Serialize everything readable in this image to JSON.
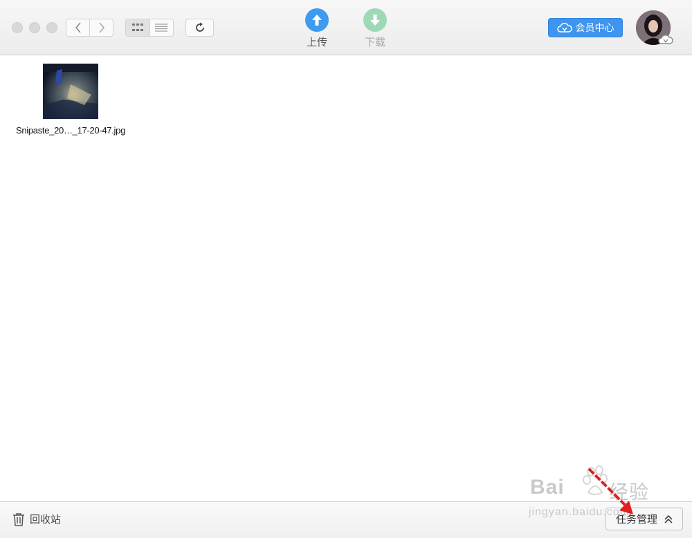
{
  "toolbar": {
    "upload_label": "上传",
    "download_label": "下载",
    "vip_label": "会员中心"
  },
  "files": [
    {
      "name": "Snipaste_20…_17-20-47.jpg"
    }
  ],
  "bottom": {
    "trash_label": "回收站",
    "task_label": "任务管理"
  },
  "watermark": {
    "brand": "Bai",
    "brand_cn": "经验",
    "url": "jingyan.baidu.com"
  },
  "colors": {
    "accent": "#3f95ee",
    "upload": "#3f9bf0",
    "download_disabled": "#9ed9b6",
    "annotation_arrow": "#e02020"
  }
}
